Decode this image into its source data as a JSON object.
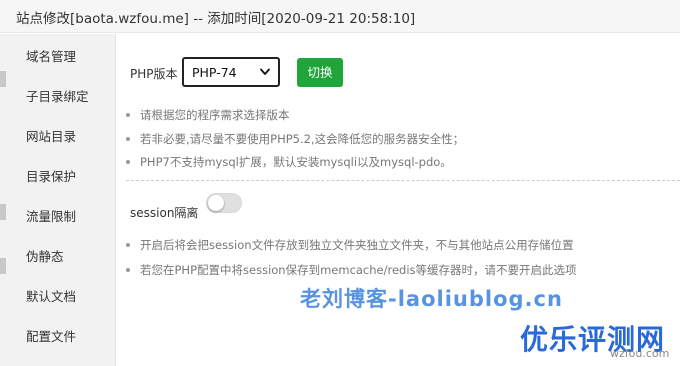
{
  "window": {
    "title": "站点修改[baota.wzfou.me] -- 添加时间[2020-09-21 20:58:10]"
  },
  "sidebar": {
    "items": [
      {
        "label": "域名管理"
      },
      {
        "label": "子目录绑定"
      },
      {
        "label": "网站目录"
      },
      {
        "label": "目录保护"
      },
      {
        "label": "流量限制"
      },
      {
        "label": "伪静态"
      },
      {
        "label": "默认文档"
      },
      {
        "label": "配置文件"
      }
    ]
  },
  "php": {
    "label": "PHP版本",
    "selected": "PHP-74",
    "switch_label": "切换"
  },
  "php_tips": [
    "请根据您的程序需求选择版本",
    "若非必要,请尽量不要使用PHP5.2,这会降低您的服务器安全性；",
    "PHP7不支持mysql扩展，默认安装mysqli以及mysql-pdo。"
  ],
  "session": {
    "label": "session隔离",
    "enabled": false
  },
  "session_tips": [
    "开启后将会把session文件存放到独立文件夹独立文件夹，不与其他站点公用存储位置",
    "若您在PHP配置中将session保存到memcache/redis等缓存器时，请不要开启此选项"
  ],
  "watermark": {
    "text": "老刘博客-laoliublog.cn",
    "logo": "优乐评测网",
    "sub": "wzfou.com"
  },
  "colors": {
    "accent": "#20a53a",
    "sidebar_bg": "#f2f2f2",
    "titlebar_bg": "#f6f6f6"
  }
}
